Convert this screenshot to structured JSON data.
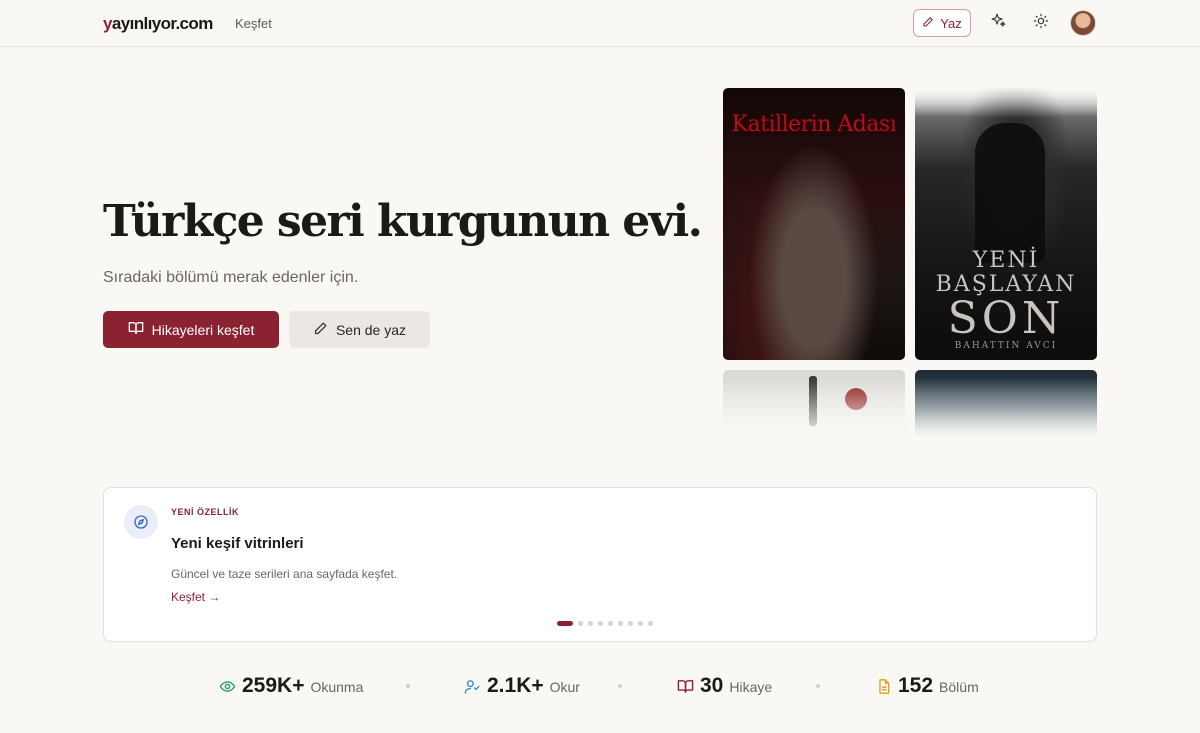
{
  "header": {
    "logo_first": "y",
    "logo_rest": "ayınlıyor.com",
    "nav_discover": "Keşfet",
    "write_label": "Yaz",
    "icons": [
      "pen-icon",
      "sparkles-icon",
      "sun-icon",
      "avatar"
    ]
  },
  "hero": {
    "title": "Türkçe seri kurgunun evi.",
    "subtitle": "Sıradaki bölümü merak edenler için.",
    "primary_button": "Hikayeleri keşfet",
    "secondary_button": "Sen de yaz"
  },
  "covers": {
    "cover1_title": "Katillerin Adası",
    "cover2_line1": "YENİ",
    "cover2_line2": "BAŞLAYAN",
    "cover2_line3": "SON",
    "cover2_author": "BAHATTIN AVCI"
  },
  "feature": {
    "eyebrow": "YENİ ÖZELLİK",
    "title": "Yeni keşif vitrinleri",
    "description": "Güncel ve taze serileri ana sayfada keşfet.",
    "link": "Keşfet →",
    "dot_count": 9,
    "active_dot": 0
  },
  "stats": [
    {
      "value": "259K+",
      "label": "Okunma",
      "icon": "eye-icon",
      "color": "#2e9e6a"
    },
    {
      "value": "2.1K+",
      "label": "Okur",
      "icon": "users-icon",
      "color": "#3a8fd0"
    },
    {
      "value": "30",
      "label": "Hikaye",
      "icon": "book-icon",
      "color": "#8b2232"
    },
    {
      "value": "152",
      "label": "Bölüm",
      "icon": "document-icon",
      "color": "#e0a020"
    }
  ],
  "colors": {
    "brand": "#8b2232",
    "background": "#f9f8f5"
  }
}
